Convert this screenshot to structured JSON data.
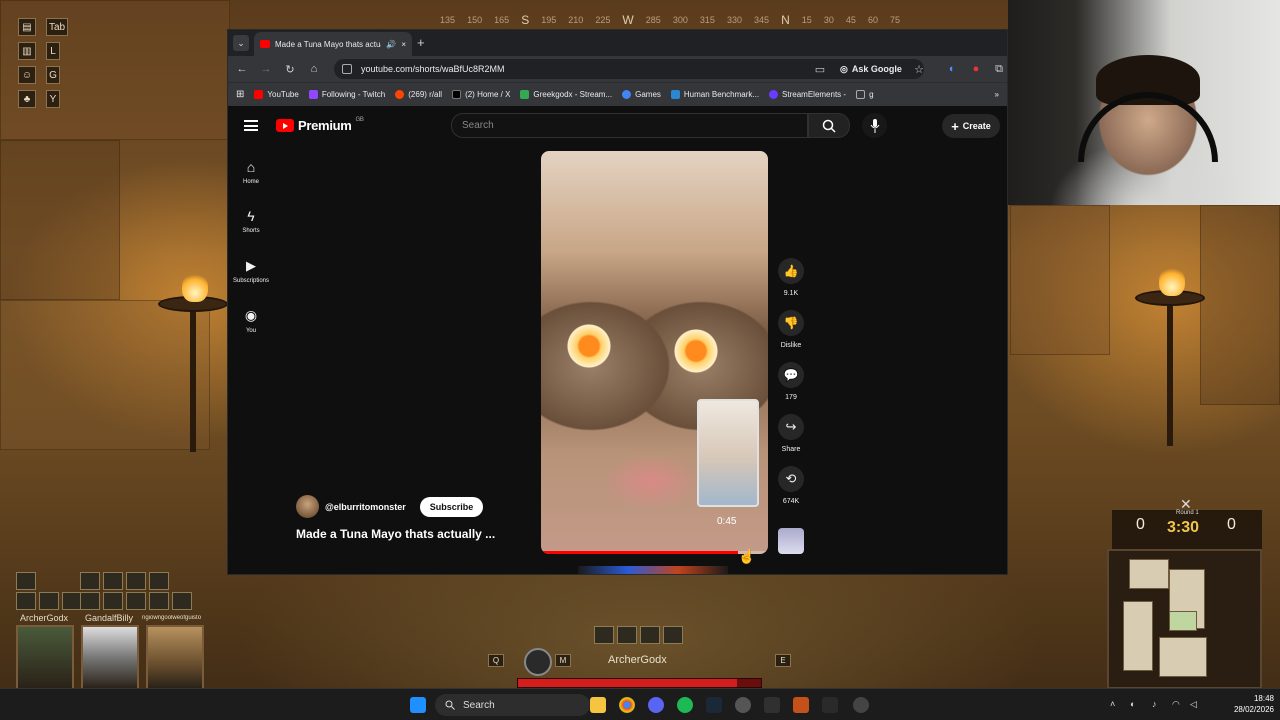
{
  "game": {
    "compass": {
      "ticks": [
        "135",
        "150",
        "165",
        "S",
        "195",
        "210",
        "225",
        "W",
        "285",
        "300",
        "315",
        "330",
        "345",
        "N",
        "15",
        "30",
        "45",
        "60",
        "75"
      ]
    },
    "hud_keys": [
      "Tab",
      "L",
      "G",
      "Y"
    ],
    "party": [
      {
        "name": "ArcherGodx"
      },
      {
        "name": "GandalfBilly"
      },
      {
        "name": "ngiowngoolweofguisto"
      }
    ],
    "character_name": "ArcherGodx",
    "action_keys": [
      "Q",
      "M",
      "E"
    ],
    "health_fraction": 0.9,
    "score": {
      "left": "0",
      "right": "0",
      "clock": "3:30",
      "round": "Round 1"
    }
  },
  "browser": {
    "tab": {
      "title": "Made a Tuna Mayo thats actually",
      "close": "×"
    },
    "new_tab": "+",
    "url": "youtube.com/shorts/waBfUc8R2MM",
    "ask_google": "Ask Google",
    "bookmarks": [
      {
        "label": "YouTube",
        "color": "#ff0000"
      },
      {
        "label": "Following - Twitch",
        "color": "#9146ff"
      },
      {
        "label": "(269) r/all",
        "color": "#ff4500"
      },
      {
        "label": "(2) Home / X",
        "color": "#000000"
      },
      {
        "label": "Greekgodx - Stream...",
        "color": "#34a853"
      },
      {
        "label": "Games",
        "color": "#4285f4"
      },
      {
        "label": "Human Benchmark...",
        "color": "#2b87d1"
      },
      {
        "label": "StreamElements -",
        "color": "#6a3cff"
      },
      {
        "label": "g",
        "color": "#888888"
      }
    ]
  },
  "youtube": {
    "logo": "Premium",
    "region": "GB",
    "search_placeholder": "Search",
    "create": "Create",
    "sidebar": [
      {
        "label": "Home"
      },
      {
        "label": "Shorts"
      },
      {
        "label": "Subscriptions"
      },
      {
        "label": "You"
      }
    ],
    "actions": {
      "likes": "9.1K",
      "dislike": "Dislike",
      "comments": "179",
      "share": "Share",
      "remix": "674K"
    },
    "video": {
      "time": "0:45",
      "progress_fraction": 0.87
    },
    "channel": {
      "handle": "@elburritomonster",
      "subscribe": "Subscribe"
    },
    "title": "Made a Tuna Mayo thats actually ..."
  },
  "taskbar": {
    "search": "Search",
    "time": "18:48",
    "date": "28/02/2026"
  }
}
